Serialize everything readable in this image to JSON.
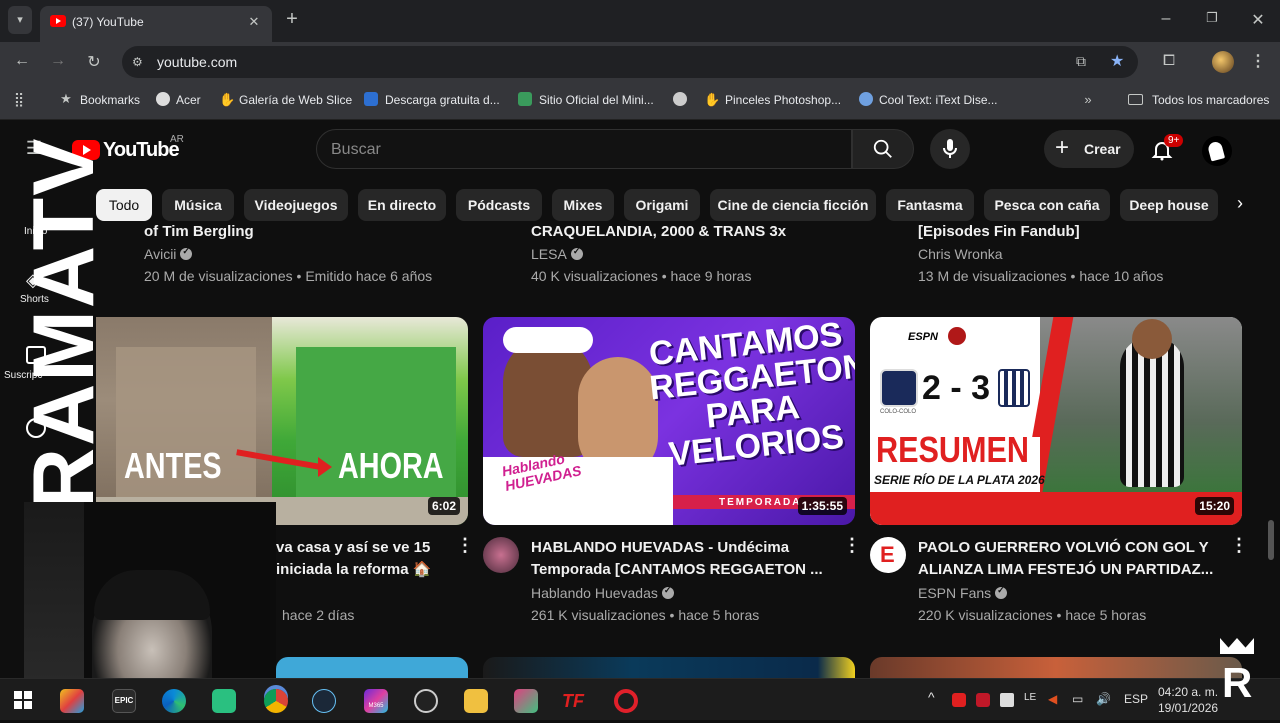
{
  "browser": {
    "tab_title": "(37) YouTube",
    "url": "youtube.com",
    "bookmarks": [
      "Bookmarks",
      "Acer",
      "Galería de Web Slice",
      "Descarga gratuita d...",
      "Sitio Oficial del Mini...",
      "Pinceles Photoshop...",
      "Cool Text: iText Dise..."
    ],
    "all_bookmarks": "Todos los marcadores"
  },
  "youtube": {
    "logo_text": "YouTube",
    "country": "AR",
    "search_placeholder": "Buscar",
    "create_label": "Crear",
    "notif_badge": "9+",
    "chips": [
      "Todo",
      "Música",
      "Videojuegos",
      "En directo",
      "Pódcasts",
      "Mixes",
      "Origami",
      "Cine de ciencia ficción",
      "Fantasma",
      "Pesca con caña",
      "Deep house"
    ],
    "side_labels": [
      "Inicio",
      "Shorts",
      "Suscripc",
      ""
    ],
    "top_row": [
      {
        "title_fragment": "of Tim Bergling",
        "channel": "Avicii",
        "stats": "20 M de visualizaciones • Emitido hace 6 años"
      },
      {
        "title_fragment": "CRAQUELANDIA, 2000 & TRANS 3x",
        "channel": "LESA",
        "stats": "40 K visualizaciones • hace 9 horas"
      },
      {
        "title_fragment": "[Episodes Fin Fandub]",
        "channel": "Chris Wronka",
        "stats": "13 M de visualizaciones • hace 10 años"
      }
    ],
    "videos": [
      {
        "thumb_left": "ANTES",
        "thumb_right": "AHORA",
        "duration": "6:02",
        "title1": "va casa y así se ve 15",
        "title2": "iniciada la reforma 🏠",
        "stats": "hace 2 días"
      },
      {
        "thumb_text": "CANTAMOS REGGAETON PARA VELORIOS",
        "thumb_badge": "Hablando HUEVADAS",
        "thumb_strip": "TEMPORADA",
        "duration": "1:35:55",
        "title1": "HABLANDO HUEVADAS - Undécima",
        "title2": "Temporada [CANTAMOS REGGAETON ...",
        "channel": "Hablando Huevadas",
        "stats": "261 K visualizaciones • hace 5 horas"
      },
      {
        "thumb_score": "2 - 3",
        "thumb_brand": "ESPN",
        "thumb_title": "RESUMEN",
        "thumb_sub": "SERIE RÍO DE LA PLATA 2026",
        "thumb_team": "COLO-COLO",
        "duration": "15:20",
        "title1": "PAOLO GUERRERO VOLVIÓ CON GOL Y",
        "title2": "ALIANZA LIMA FESTEJÓ UN PARTIDAZ...",
        "channel": "ESPN Fans",
        "stats": "220 K visualizaciones • hace 5 horas"
      }
    ]
  },
  "overlay": {
    "vertical_text": "RAMATV"
  },
  "taskbar": {
    "lang": "ESP",
    "time": "04:20 a. m.",
    "date": "19/01/2026",
    "epic_label": "EPIC",
    "tf_label": "TF",
    "m365_label": "M365",
    "tray_text": "LE"
  }
}
